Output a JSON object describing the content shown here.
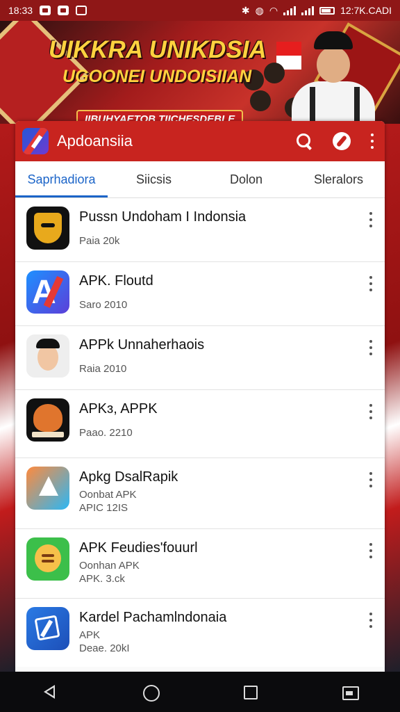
{
  "status_bar": {
    "time": "18:33",
    "right_text": "12:7K.CADI"
  },
  "banner": {
    "title": "UIKKRA UNIKDSIA",
    "subtitle": "UGOONEI UNDOISIIAN",
    "tagline": "IIBUHYAETOB TIICHESDEBLE"
  },
  "appbar": {
    "title": "Apdoansiia",
    "accent_color": "#c8241f"
  },
  "tabs": [
    {
      "label": "Saprhadiora",
      "active": true
    },
    {
      "label": "Siicsis",
      "active": false
    },
    {
      "label": "Dolon",
      "active": false
    },
    {
      "label": "Sleralors",
      "active": false
    }
  ],
  "apps": [
    {
      "name": "Pussn Undoham I Indonsia",
      "sub": "Paia 20k",
      "sub2": "",
      "icon": "mask-icon"
    },
    {
      "name": "APK. Floutd",
      "sub": "Saro 2010",
      "sub2": "",
      "icon": "apk-letter-a-icon"
    },
    {
      "name": "APPk Unnaherhaois",
      "sub": "Raia 2010",
      "sub2": "",
      "icon": "cartoon-face-icon"
    },
    {
      "name": "APKɜ, APPK",
      "sub": "Paao. 2210",
      "sub2": "",
      "icon": "tiger-icon"
    },
    {
      "name": "Apkg DsalRapik",
      "sub": "Oonbat APK",
      "sub2": "APIC 12IS",
      "icon": "triangle-play-icon"
    },
    {
      "name": "APK Feudies'fouurl",
      "sub": "Oonhan APK",
      "sub2": "APK. 3.ck",
      "icon": "smiling-character-icon"
    },
    {
      "name": "Kardel Pachamlndonaia",
      "sub": "APK",
      "sub2": "Deae. 20kI",
      "icon": "blue-box-icon"
    }
  ],
  "colors": {
    "tab_active": "#1b64c8",
    "status_bar": "#8f1717"
  }
}
